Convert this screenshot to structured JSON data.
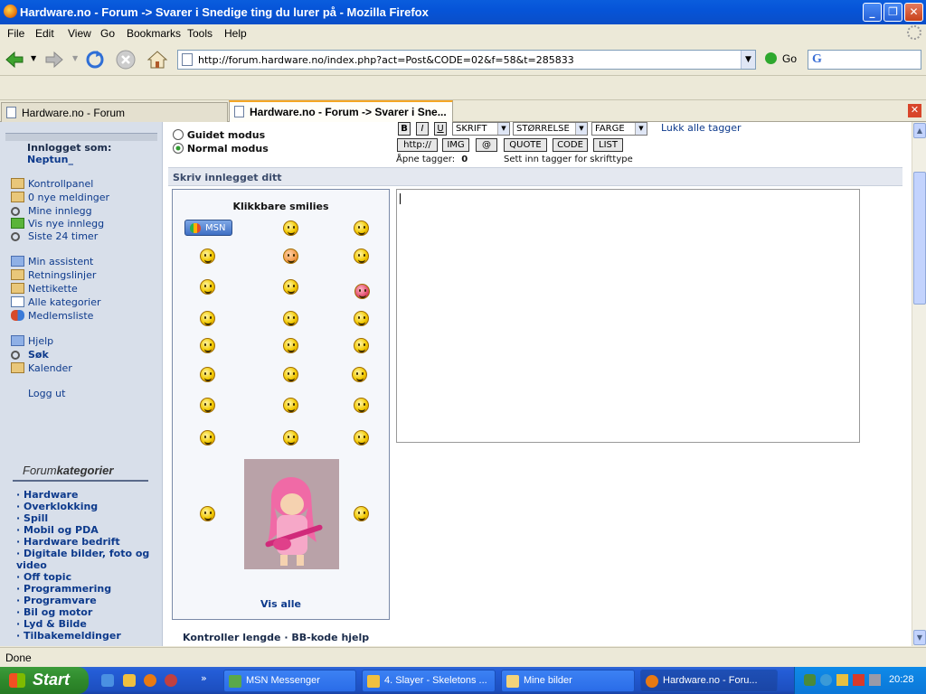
{
  "window": {
    "title": "Hardware.no - Forum -> Svarer i Snedige ting du lurer på - Mozilla Firefox"
  },
  "menubar": [
    "File",
    "Edit",
    "View",
    "Go",
    "Bookmarks",
    "Tools",
    "Help"
  ],
  "navbar": {
    "url": "http://forum.hardware.no/index.php?act=Post&CODE=02&f=58&t=285833",
    "go_label": "Go"
  },
  "tabs": [
    {
      "label": "Hardware.no - Forum"
    },
    {
      "label": "Hardware.no - Forum -> Svarer i Sne..."
    }
  ],
  "sidebar": {
    "logged_in_label": "Innlogget som:",
    "username": "Neptun_",
    "links": [
      {
        "label": "Kontrollpanel",
        "icon": "pencil-folder-icon"
      },
      {
        "label": "0 nye meldinger",
        "icon": "pencil-folder-icon"
      },
      {
        "label": "Mine innlegg",
        "icon": "magnifier-icon"
      },
      {
        "label": "Vis nye innlegg",
        "icon": "envelope-icon"
      },
      {
        "label": "Siste 24 timer",
        "icon": "magnifier-icon"
      }
    ],
    "links2": [
      {
        "label": "Min assistent",
        "icon": "help-icon"
      },
      {
        "label": "Retningslinjer",
        "icon": "pencil-folder-icon"
      },
      {
        "label": "Nettikette",
        "icon": "pencil-folder-icon"
      },
      {
        "label": "Alle kategorier",
        "icon": "list-icon"
      },
      {
        "label": "Medlemsliste",
        "icon": "users-icon"
      }
    ],
    "links3": [
      {
        "label": "Hjelp",
        "icon": "help-icon"
      },
      {
        "label": "Søk",
        "icon": "magnifier-icon"
      },
      {
        "label": "Kalender",
        "icon": "pencil-folder-icon"
      }
    ],
    "logout": "Logg ut",
    "categories_title_a": "Forum",
    "categories_title_b": "kategorier",
    "categories": [
      "Hardware",
      "Overklokking",
      "Spill",
      "Mobil og PDA",
      "Hardware bedrift",
      "Digitale bilder, foto og",
      "video",
      "Off topic",
      "Programmering",
      "Programvare",
      "Bil og motor",
      "Lyd & Bilde",
      "Tilbakemeldinger"
    ]
  },
  "editor": {
    "mode_guided": "Guidet modus",
    "mode_normal": "Normal modus",
    "format_b": "B",
    "format_i": "I",
    "format_u": "U",
    "select_font": "SKRIFT",
    "select_size": "STØRRELSE",
    "select_color": "FARGE",
    "close_tags": "Lukk alle tagger",
    "buttons": [
      "http://",
      "IMG",
      "@",
      "QUOTE",
      "CODE",
      "LIST"
    ],
    "open_tags_label": "Åpne tagger:",
    "open_tags_count": "0",
    "font_hint": "Sett inn tagger for skrifttype",
    "write_header": "Skriv innlegget ditt",
    "smilies_title": "Klikkbare smilies",
    "msn_badge": "MSN",
    "show_all": "Vis alle",
    "check_length": "Kontroller lengde",
    "separator": "·",
    "bb_help": "BB-kode hjelp"
  },
  "statusbar": {
    "text": "Done"
  },
  "taskbar": {
    "start": "Start",
    "items": [
      {
        "label": "MSN Messenger"
      },
      {
        "label": "4. Slayer - Skeletons ..."
      },
      {
        "label": "Mine bilder"
      },
      {
        "label": "Hardware.no - Foru..."
      }
    ],
    "clock": "20:28"
  },
  "colors": {
    "sidebar_bg": "#d8dfea",
    "link_blue": "#0d3a8c",
    "header_bg": "#e4e8f0"
  }
}
